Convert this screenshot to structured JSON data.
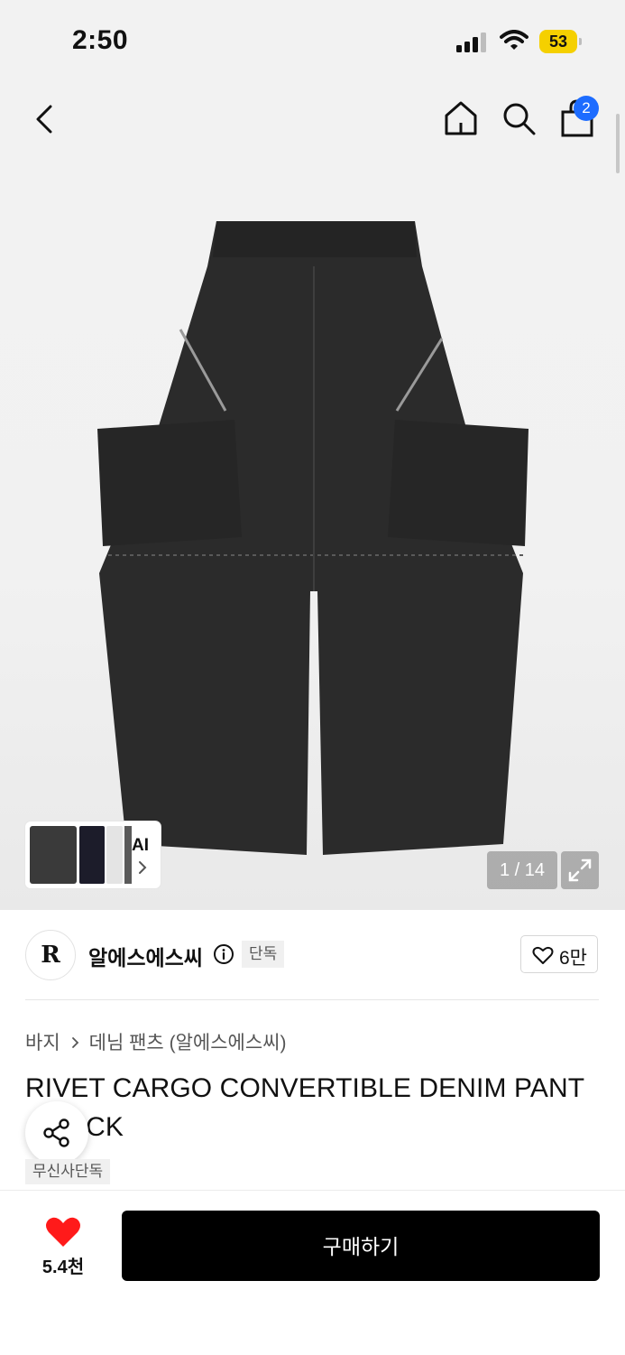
{
  "status_bar": {
    "time": "2:50",
    "battery": "53"
  },
  "nav": {
    "cart_count": "2"
  },
  "gallery": {
    "counter": "1 / 14",
    "ai_label": "AI"
  },
  "brand": {
    "logo": "R",
    "name": "알에스에스씨",
    "tag": "단독",
    "likes": "6만"
  },
  "breadcrumb": {
    "category": "바지",
    "subcategory": "데님 팬츠 (알에스에스씨)"
  },
  "product": {
    "title": "RIVET CARGO CONVERTIBLE DENIM PANT (BLACK",
    "exclusive_tag": "무신사단독"
  },
  "bottom_bar": {
    "likes": "5.4천",
    "buy_label": "구매하기"
  },
  "colors": {
    "accent_blue": "#1d6cff",
    "heart_red": "#ff1a1a",
    "battery_yellow": "#f5d000"
  },
  "icons": [
    "back-icon",
    "home-icon",
    "search-icon",
    "cart-icon",
    "chevron-right-icon",
    "expand-icon",
    "info-icon",
    "heart-outline-icon",
    "share-icon",
    "heart-filled-icon"
  ]
}
